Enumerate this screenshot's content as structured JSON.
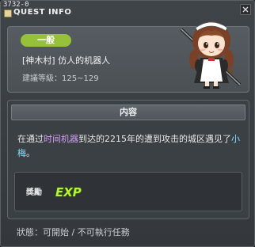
{
  "window": {
    "quest_id": "3732-0",
    "title": "QUEST INFO",
    "icons": {
      "title": "quest-info-icon",
      "close": "close-icon"
    }
  },
  "quest": {
    "category": "一般",
    "name": "[神木村] 仿人的机器人",
    "level_label": "建議等級：",
    "level_range": "125~129",
    "npc_icon": "maid-npc-portrait"
  },
  "content": {
    "header": "内容",
    "description": {
      "part1": "在通过",
      "highlight1": "时间机器",
      "part2": "到达的2215年的遭到攻击的城区遇见了",
      "highlight2": "小梅",
      "part3": "。"
    },
    "reward_label": "獎勵",
    "reward_item": "EXP"
  },
  "status": {
    "label": "狀態：",
    "value": "可開始 / 不可執行任務"
  },
  "colors": {
    "badge": "#97c03b",
    "highlight_purple": "#d59ef5",
    "highlight_cyan": "#7fe3ff",
    "exp": "#b7f23a"
  }
}
